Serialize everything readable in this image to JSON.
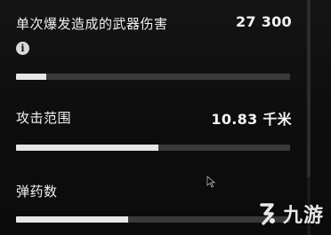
{
  "stats": [
    {
      "label": "单次爆发造成的武器伤害",
      "value": "27 300",
      "bar_fraction": 0.11,
      "has_info": true
    },
    {
      "label": "攻击范围",
      "value": "10.83 千米",
      "bar_fraction": 0.52
    },
    {
      "label": "弹药数",
      "value": "",
      "bar_fraction": 0.41
    }
  ],
  "info_icon": {
    "glyph": "i"
  },
  "watermark": {
    "text": "九游",
    "icon": "logo-icon"
  },
  "colors": {
    "background": "#0b0b0b",
    "bar_track": "#3a3a3a",
    "bar_fill": "#e6e6e6",
    "text": "#f1f1f1"
  }
}
